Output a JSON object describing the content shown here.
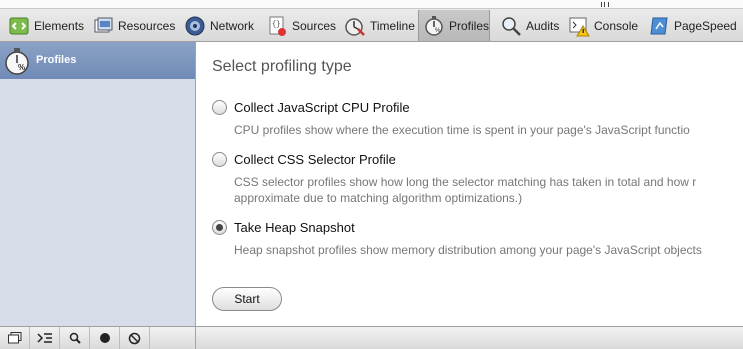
{
  "toolbar": {
    "tabs": [
      {
        "label": "Elements",
        "icon": "elements-icon"
      },
      {
        "label": "Resources",
        "icon": "resources-icon"
      },
      {
        "label": "Network",
        "icon": "network-icon"
      },
      {
        "label": "Sources",
        "icon": "sources-icon"
      },
      {
        "label": "Timeline",
        "icon": "timeline-icon"
      },
      {
        "label": "Profiles",
        "icon": "profiles-icon",
        "selected": true
      },
      {
        "label": "Audits",
        "icon": "audits-icon"
      },
      {
        "label": "Console",
        "icon": "console-icon"
      },
      {
        "label": "PageSpeed",
        "icon": "pagespeed-icon"
      }
    ]
  },
  "sidebar": {
    "selected_item": {
      "label": "Profiles",
      "icon": "stopwatch-icon"
    }
  },
  "main": {
    "heading": "Select profiling type",
    "options": [
      {
        "label": "Collect JavaScript CPU Profile",
        "description": "CPU profiles show where the execution time is spent in your page's JavaScript functio",
        "checked": false
      },
      {
        "label": "Collect CSS Selector Profile",
        "description": "CSS selector profiles show how long the selector matching has taken in total and how r",
        "description2": "approximate due to matching algorithm optimizations.)",
        "checked": false
      },
      {
        "label": "Take Heap Snapshot",
        "description": "Heap snapshot profiles show memory distribution among your page's JavaScript objects",
        "checked": true
      }
    ],
    "start_label": "Start"
  },
  "statusbar": {
    "buttons": [
      "dock-icon",
      "console-toggle-icon",
      "search-icon",
      "record-icon",
      "clear-icon"
    ]
  },
  "colors": {
    "sidebar_bg": "#d6dde8",
    "sidebar_selected": "#7a94bd",
    "description_text": "#777777"
  }
}
